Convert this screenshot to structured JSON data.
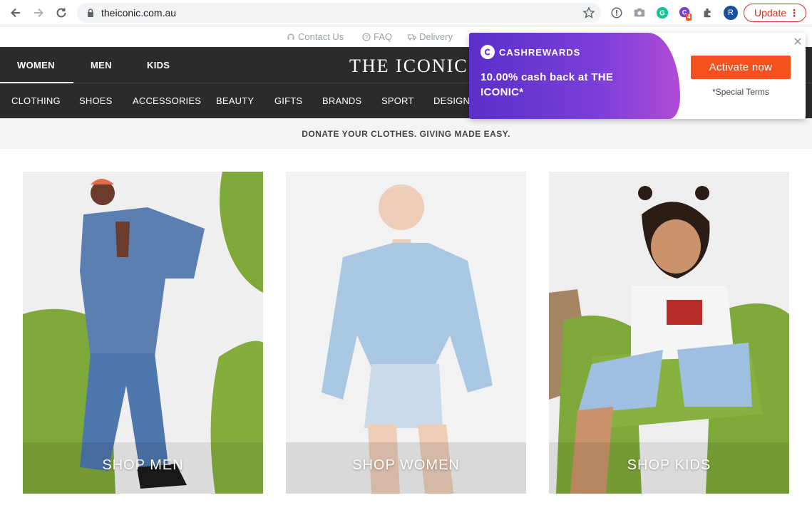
{
  "browser": {
    "url": "theiconic.com.au",
    "update_label": "Update",
    "profile_initial": "R",
    "extension_badge": "4"
  },
  "utility": {
    "contact": "Contact Us",
    "faq": "FAQ",
    "delivery": "Delivery"
  },
  "header": {
    "logo": "THE ICONIC",
    "genders": [
      "WOMEN",
      "MEN",
      "KIDS"
    ],
    "categories": [
      "CLOTHING",
      "SHOES",
      "ACCESSORIES",
      "BEAUTY",
      "GIFTS",
      "BRANDS",
      "SPORT",
      "DESIGNE"
    ]
  },
  "banner": {
    "text": "DONATE YOUR CLOTHES. GIVING MADE EASY."
  },
  "tiles": [
    {
      "label": "SHOP MEN"
    },
    {
      "label": "SHOP WOMEN"
    },
    {
      "label": "SHOP KIDS"
    }
  ],
  "popup": {
    "brand": "CASHREWARDS",
    "offer": "10.00% cash back at THE ICONIC*",
    "activate_label": "Activate now",
    "terms": "*Special Terms"
  },
  "colors": {
    "header_bg": "#2b2b2b",
    "activate": "#f4511e",
    "cashrewards_purple": "#6a35d0"
  }
}
